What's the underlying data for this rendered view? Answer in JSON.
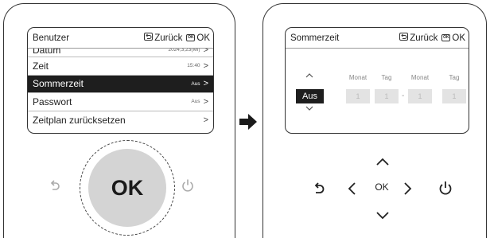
{
  "left_panel": {
    "header": {
      "title": "Benutzer",
      "back_label": "Zurück",
      "ok_label": "OK",
      "ok_icon_text": "OK"
    },
    "menu": [
      {
        "label": "Datum",
        "value": "2024,3,23(Mi)",
        "chevron": ">"
      },
      {
        "label": "Zeit",
        "value": "15:40",
        "chevron": ">"
      },
      {
        "label": "Sommerzeit",
        "value": "Aus",
        "chevron": ">",
        "selected": true
      },
      {
        "label": "Passwort",
        "value": "Aus",
        "chevron": ">"
      },
      {
        "label": "Zeitplan zurücksetzen",
        "value": "",
        "chevron": ">"
      }
    ],
    "knob_label": "OK"
  },
  "right_panel": {
    "header": {
      "title": "Sommerzeit",
      "back_label": "Zurück",
      "ok_label": "OK",
      "ok_icon_text": "OK"
    },
    "toggle": {
      "value": "Aus",
      "up": "^",
      "down": "v"
    },
    "date_columns": [
      "Monat",
      "Tag",
      "Monat",
      "Tag"
    ],
    "date_values": [
      "1",
      "1",
      "1",
      "1"
    ],
    "date_separator": "-",
    "nav_ok_label": "OK"
  },
  "icons": {
    "back": "back-arrow-icon",
    "power": "power-icon",
    "transition": "right-arrow-icon",
    "nav": [
      "chevron-up-icon",
      "chevron-left-icon",
      "chevron-right-icon",
      "chevron-down-icon"
    ]
  }
}
